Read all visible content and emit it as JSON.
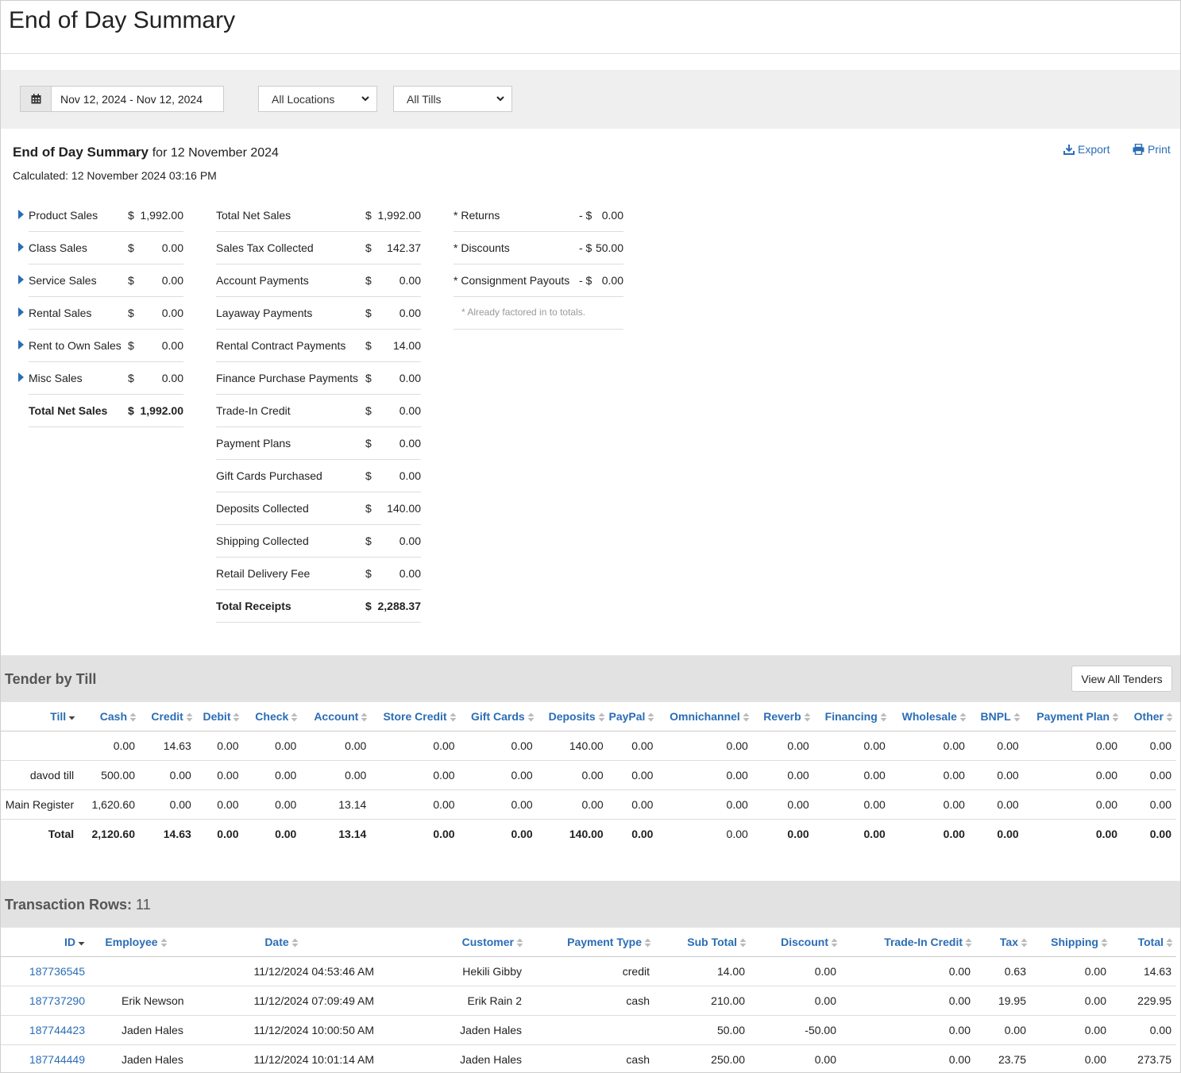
{
  "header": {
    "title": "End of Day Summary"
  },
  "filters": {
    "date_range": "Nov 12, 2024 - Nov 12, 2024",
    "calendar_icon": "calendar-icon",
    "location": "All Locations",
    "till": "All Tills"
  },
  "summary": {
    "title": "End of Day Summary",
    "for_date": "for 12 November 2024",
    "calculated": "Calculated: 12 November 2024 03:16 PM",
    "export_label": "Export",
    "print_label": "Print",
    "col1": [
      {
        "label": "Product Sales",
        "dollar": "$",
        "value": "1,992.00"
      },
      {
        "label": "Class Sales",
        "dollar": "$",
        "value": "0.00"
      },
      {
        "label": "Service Sales",
        "dollar": "$",
        "value": "0.00"
      },
      {
        "label": "Rental Sales",
        "dollar": "$",
        "value": "0.00"
      },
      {
        "label": "Rent to Own Sales",
        "dollar": "$",
        "value": "0.00"
      },
      {
        "label": "Misc Sales",
        "dollar": "$",
        "value": "0.00"
      }
    ],
    "col1_total": {
      "label": "Total Net Sales",
      "dollar": "$",
      "value": "1,992.00"
    },
    "col2": [
      {
        "label": "Total Net Sales",
        "dollar": "$",
        "value": "1,992.00"
      },
      {
        "label": "Sales Tax Collected",
        "dollar": "$",
        "value": "142.37"
      },
      {
        "label": "Account Payments",
        "dollar": "$",
        "value": "0.00"
      },
      {
        "label": "Layaway Payments",
        "dollar": "$",
        "value": "0.00"
      },
      {
        "label": "Rental Contract Payments",
        "dollar": "$",
        "value": "14.00"
      },
      {
        "label": "Finance Purchase Payments",
        "dollar": "$",
        "value": "0.00"
      },
      {
        "label": "Trade-In Credit",
        "dollar": "$",
        "value": "0.00"
      },
      {
        "label": "Payment Plans",
        "dollar": "$",
        "value": "0.00"
      },
      {
        "label": "Gift Cards Purchased",
        "dollar": "$",
        "value": "0.00"
      },
      {
        "label": "Deposits Collected",
        "dollar": "$",
        "value": "140.00"
      },
      {
        "label": "Shipping Collected",
        "dollar": "$",
        "value": "0.00"
      },
      {
        "label": "Retail Delivery Fee",
        "dollar": "$",
        "value": "0.00"
      }
    ],
    "col2_total": {
      "label": "Total Receipts",
      "dollar": "$",
      "value": "2,288.37"
    },
    "col3": [
      {
        "label": "* Returns",
        "dollar": "- $",
        "value": "0.00"
      },
      {
        "label": "* Discounts",
        "dollar": "- $",
        "value": "50.00"
      },
      {
        "label": "* Consignment Payouts",
        "dollar": "- $",
        "value": "0.00"
      }
    ],
    "col3_note": "* Already factored in to totals."
  },
  "tender": {
    "heading": "Tender by Till",
    "view_all_label": "View All Tenders",
    "columns": [
      "Till",
      "Cash",
      "Credit",
      "Debit",
      "Check",
      "Account",
      "Store Credit",
      "Gift Cards",
      "Deposits",
      "PayPal",
      "Omnichannel",
      "Reverb",
      "Financing",
      "Wholesale",
      "BNPL",
      "Payment Plan",
      "Other"
    ],
    "rows": [
      [
        "",
        "0.00",
        "14.63",
        "0.00",
        "0.00",
        "0.00",
        "0.00",
        "0.00",
        "140.00",
        "0.00",
        "0.00",
        "0.00",
        "0.00",
        "0.00",
        "0.00",
        "0.00",
        "0.00"
      ],
      [
        "davod till",
        "500.00",
        "0.00",
        "0.00",
        "0.00",
        "0.00",
        "0.00",
        "0.00",
        "0.00",
        "0.00",
        "0.00",
        "0.00",
        "0.00",
        "0.00",
        "0.00",
        "0.00",
        "0.00"
      ],
      [
        "Main Register",
        "1,620.60",
        "0.00",
        "0.00",
        "0.00",
        "13.14",
        "0.00",
        "0.00",
        "0.00",
        "0.00",
        "0.00",
        "0.00",
        "0.00",
        "0.00",
        "0.00",
        "0.00",
        "0.00"
      ]
    ],
    "total": [
      "Total",
      "2,120.60",
      "14.63",
      "0.00",
      "0.00",
      "13.14",
      "0.00",
      "0.00",
      "140.00",
      "0.00",
      "0.00",
      "0.00",
      "0.00",
      "0.00",
      "0.00",
      "0.00",
      "0.00"
    ]
  },
  "transactions": {
    "heading": "Transaction Rows:",
    "count": "11",
    "columns": [
      "ID",
      "Employee",
      "Date",
      "Customer",
      "Payment Type",
      "Sub Total",
      "Discount",
      "Trade-In Credit",
      "Tax",
      "Shipping",
      "Total"
    ],
    "rows": [
      [
        "187736545",
        "",
        "11/12/2024 04:53:46 AM",
        "Hekili Gibby",
        "credit",
        "14.00",
        "0.00",
        "0.00",
        "0.63",
        "0.00",
        "14.63"
      ],
      [
        "187737290",
        "Erik Newson",
        "11/12/2024 07:09:49 AM",
        "Erik Rain 2",
        "cash",
        "210.00",
        "0.00",
        "0.00",
        "19.95",
        "0.00",
        "229.95"
      ],
      [
        "187744423",
        "Jaden Hales",
        "11/12/2024 10:00:50 AM",
        "Jaden Hales",
        "",
        "50.00",
        "-50.00",
        "0.00",
        "0.00",
        "0.00",
        "0.00"
      ],
      [
        "187744449",
        "Jaden Hales",
        "11/12/2024 10:01:14 AM",
        "Jaden Hales",
        "cash",
        "250.00",
        "0.00",
        "0.00",
        "23.75",
        "0.00",
        "273.75"
      ]
    ]
  }
}
